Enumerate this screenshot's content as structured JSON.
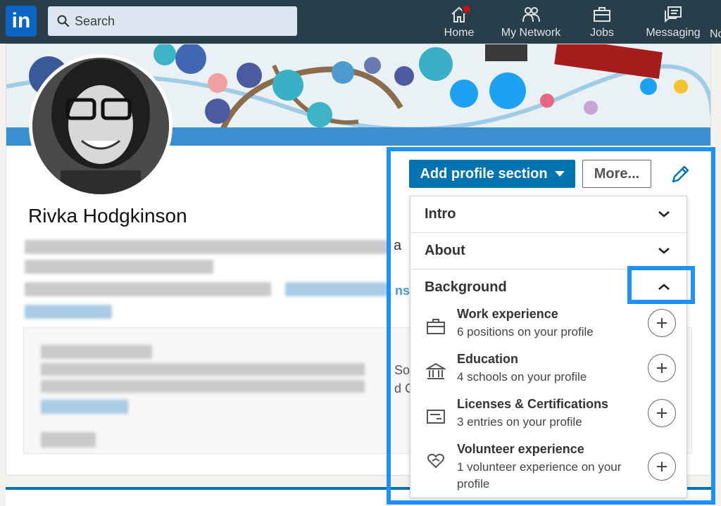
{
  "nav": {
    "logo": "in",
    "search_placeholder": "Search",
    "items": [
      {
        "label": "Home"
      },
      {
        "label": "My Network"
      },
      {
        "label": "Jobs"
      },
      {
        "label": "Messaging"
      },
      {
        "label": "No"
      }
    ]
  },
  "profile": {
    "name": "Rivka Hodgkinson",
    "partial_text": {
      "a": "a",
      "ns": "ns",
      "so": "So",
      "dc": "d C"
    }
  },
  "actions": {
    "add_section_label": "Add profile section",
    "more_label": "More..."
  },
  "dropdown": {
    "sections": [
      {
        "label": "Intro",
        "expanded": false
      },
      {
        "label": "About",
        "expanded": false
      },
      {
        "label": "Background",
        "expanded": true
      }
    ],
    "items": [
      {
        "title": "Work experience",
        "subtitle": "6 positions on your profile",
        "icon": "briefcase-icon"
      },
      {
        "title": "Education",
        "subtitle": "4 schools on your profile",
        "icon": "school-icon"
      },
      {
        "title": "Licenses & Certifications",
        "subtitle": "3 entries on your profile",
        "icon": "certificate-icon"
      },
      {
        "title": "Volunteer experience",
        "subtitle": "1 volunteer experience on your profile",
        "icon": "heart-hand-icon"
      }
    ]
  },
  "colors": {
    "nav_bg": "#283e4a",
    "brand_blue": "#0073b1",
    "highlight": "#1e90ff",
    "notification": "#cc1016"
  }
}
